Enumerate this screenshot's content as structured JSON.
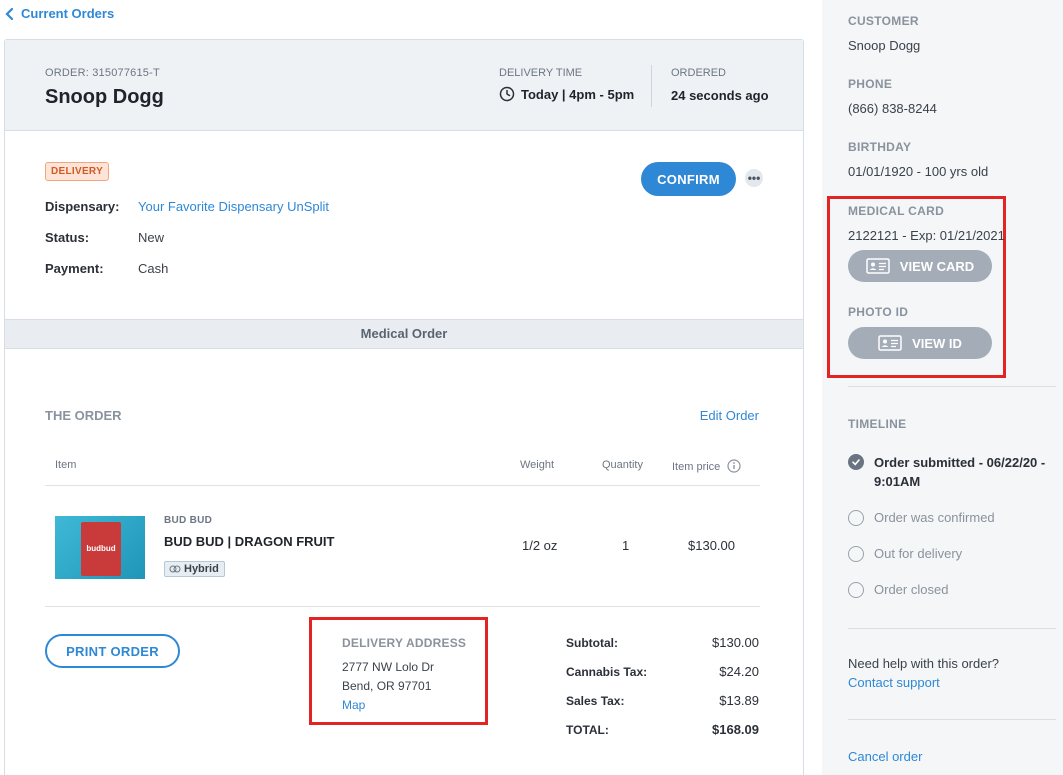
{
  "nav": {
    "back_label": "Current Orders"
  },
  "header": {
    "order_label": "ORDER: 315077615-T",
    "customer_name": "Snoop Dogg",
    "delivery_time_label": "DELIVERY TIME",
    "delivery_time_value": "Today | 4pm - 5pm",
    "ordered_label": "ORDERED",
    "ordered_value": "24 seconds ago"
  },
  "details": {
    "badge": "DELIVERY",
    "confirm_label": "CONFIRM",
    "more_label": "•••",
    "rows": [
      {
        "label": "Dispensary:",
        "value": "Your Favorite Dispensary UnSplit"
      },
      {
        "label": "Status:",
        "value": "New"
      },
      {
        "label": "Payment:",
        "value": "Cash"
      }
    ]
  },
  "band": {
    "label": "Medical Order"
  },
  "order": {
    "title": "THE ORDER",
    "edit_label": "Edit Order",
    "columns": [
      "Item",
      "Weight",
      "Quantity",
      "Item price"
    ],
    "items": [
      {
        "brand": "BUD BUD",
        "name": "BUD BUD | DRAGON FRUIT",
        "strain": "Hybrid",
        "weight": "1/2 oz",
        "quantity": "1",
        "price": "$130.00",
        "image_text": "budbud"
      }
    ],
    "print_label": "PRINT ORDER"
  },
  "address": {
    "title": "DELIVERY ADDRESS",
    "line1": "2777 NW Lolo Dr",
    "line2": "Bend, OR 97701",
    "map_label": "Map"
  },
  "totals": [
    {
      "label": "Subtotal:",
      "value": "$130.00"
    },
    {
      "label": "Cannabis Tax:",
      "value": "$24.20"
    },
    {
      "label": "Sales Tax:",
      "value": "$13.89"
    },
    {
      "label": "TOTAL:",
      "value": "$168.09"
    }
  ],
  "sidebar": {
    "customer_label": "CUSTOMER",
    "customer_value": "Snoop Dogg",
    "phone_label": "PHONE",
    "phone_value": "(866) 838-8244",
    "birthday_label": "BIRTHDAY",
    "birthday_value": "01/01/1920 - 100 yrs old",
    "medical_card_label": "MEDICAL CARD",
    "medical_card_value": "2122121 - Exp: 01/21/2021",
    "view_card_label": "VIEW CARD",
    "photo_id_label": "PHOTO ID",
    "view_id_label": "VIEW ID",
    "timeline_label": "TIMELINE",
    "timeline": [
      {
        "line1": "Order submitted - 06/22/20 -",
        "line2": "9:01AM",
        "done": true
      },
      {
        "line1": "Order was confirmed",
        "done": false
      },
      {
        "line1": "Out for delivery",
        "done": false
      },
      {
        "line1": "Order closed",
        "done": false
      }
    ],
    "help_text": "Need help with this order?",
    "help_link": "Contact support",
    "cancel_label": "Cancel order"
  },
  "colors": {
    "accent": "#2f88d5",
    "highlight": "#e32424",
    "badge": "#d05a25"
  }
}
